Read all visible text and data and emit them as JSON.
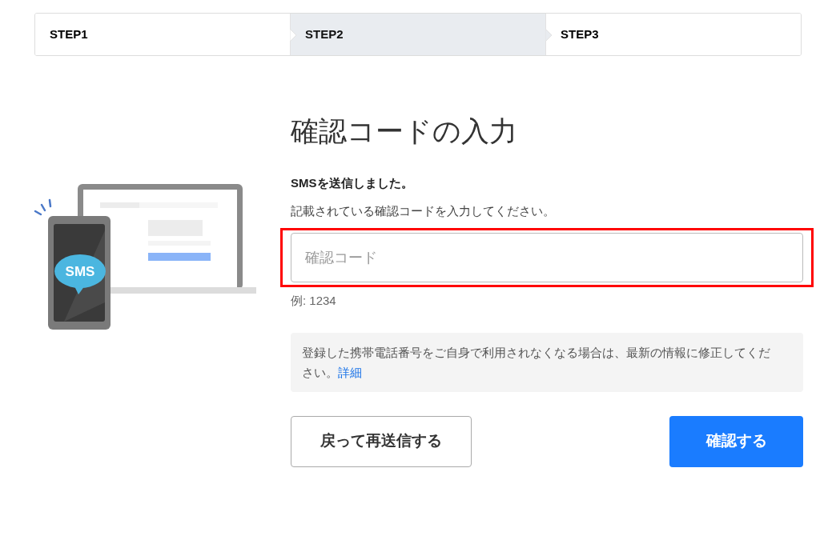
{
  "steps": [
    {
      "label": "STEP1",
      "selected": false
    },
    {
      "label": "STEP2",
      "selected": true
    },
    {
      "label": "STEP3",
      "selected": false
    }
  ],
  "illustration": {
    "bubble_text": "SMS"
  },
  "title": "確認コードの入力",
  "lead": "SMSを送信しました。",
  "instruction": "記載されている確認コードを入力してください。",
  "code_field": {
    "placeholder": "確認コード",
    "highlighted": true
  },
  "example": "例: 1234",
  "notice": {
    "text": "登録した携帯電話番号をご自身で利用されなくなる場合は、最新の情報に修正してください。",
    "link": "詳細"
  },
  "buttons": [
    {
      "label": "戻って再送信する",
      "kind": "secondary"
    },
    {
      "label": "確認する",
      "kind": "primary"
    }
  ]
}
